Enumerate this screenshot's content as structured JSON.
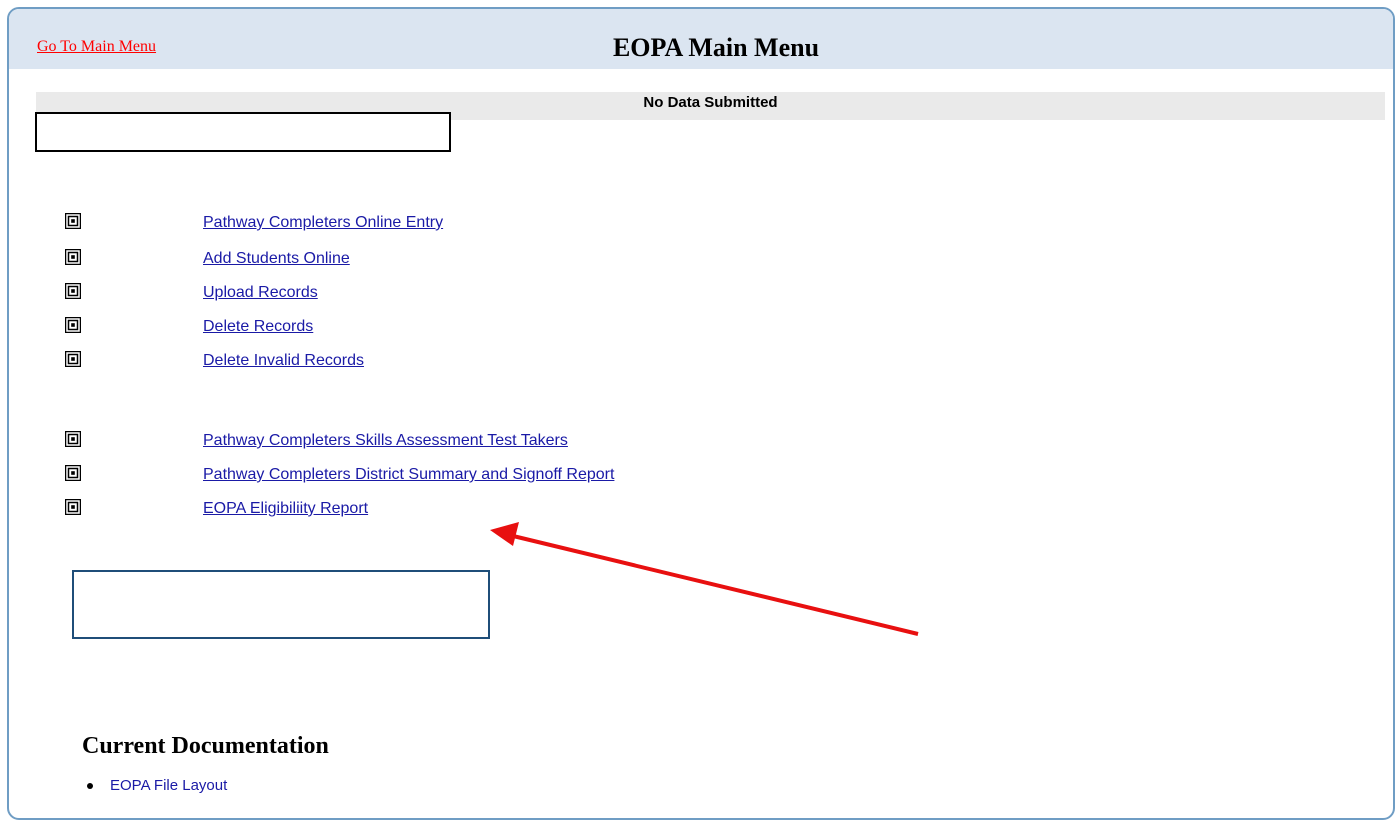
{
  "header": {
    "go_main_menu": "Go To Main Menu",
    "title": "EOPA Main Menu"
  },
  "status": {
    "text": "No Data Submitted"
  },
  "menu_group_1": [
    {
      "label": "Pathway Completers Online Entry",
      "icon": "maze-icon"
    },
    {
      "label": "Add Students Online",
      "icon": "maze-icon"
    },
    {
      "label": "Upload Records",
      "icon": "maze-icon"
    },
    {
      "label": "Delete Records",
      "icon": "maze-icon"
    },
    {
      "label": "Delete Invalid Records",
      "icon": "maze-icon"
    }
  ],
  "menu_group_2": [
    {
      "label": "Pathway Completers Skills Assessment Test Takers",
      "icon": "maze-icon"
    },
    {
      "label": "Pathway Completers District Summary and Signoff Report",
      "icon": "maze-icon"
    },
    {
      "label": "EOPA Eligibiliity Report",
      "icon": "maze-icon"
    }
  ],
  "documentation": {
    "heading": "Current Documentation",
    "items": [
      {
        "label": "EOPA File Layout"
      }
    ]
  },
  "colors": {
    "frame_border": "#6f9dc4",
    "header_bg": "#dbe5f1",
    "link": "#1a1aa6",
    "go_main_link": "#ff0000",
    "annotation_arrow": "#e81010"
  }
}
